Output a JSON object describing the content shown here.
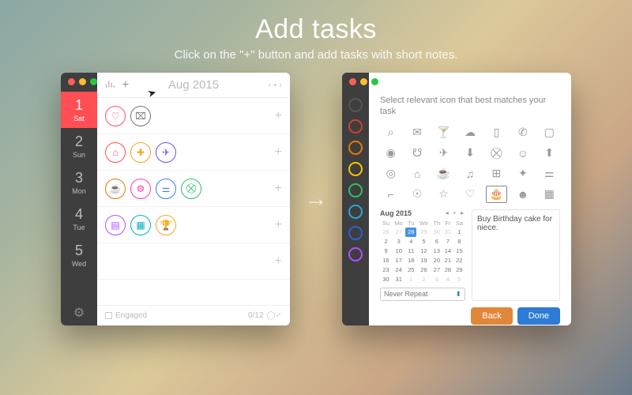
{
  "hero": {
    "title": "Add tasks",
    "subtitle": "Click on the \"+\" button and add tasks with short notes."
  },
  "left": {
    "month_label": "Aug 2015",
    "days": [
      {
        "num": "1",
        "dow": "Sat",
        "selected": true
      },
      {
        "num": "2",
        "dow": "Sun",
        "selected": false
      },
      {
        "num": "3",
        "dow": "Mon",
        "selected": false
      },
      {
        "num": "4",
        "dow": "Tue",
        "selected": false
      },
      {
        "num": "5",
        "dow": "Wed",
        "selected": false
      }
    ],
    "rows": [
      [
        {
          "icon": "heart",
          "color": "#ff4f6e"
        },
        {
          "icon": "card",
          "color": "#777"
        }
      ],
      [
        {
          "icon": "home",
          "color": "#ff4f55"
        },
        {
          "icon": "med",
          "color": "#f5a623"
        },
        {
          "icon": "plane",
          "color": "#6e50ff"
        }
      ],
      [
        {
          "icon": "cup",
          "color": "#e07b00"
        },
        {
          "icon": "bike",
          "color": "#ff3ea5"
        },
        {
          "icon": "dumbbell",
          "color": "#3b7cff"
        },
        {
          "icon": "cart",
          "color": "#2bbf6a"
        }
      ],
      [
        {
          "icon": "clipboard",
          "color": "#b24fff"
        },
        {
          "icon": "calendar",
          "color": "#00b1c9"
        },
        {
          "icon": "trophy",
          "color": "#f5a623"
        }
      ],
      []
    ],
    "footer": {
      "engaged": "Engaged",
      "count": "0/12"
    }
  },
  "right": {
    "prompt": "Select relevant icon that best matches your task",
    "colors": [
      "#555",
      "#d0402f",
      "#e07b00",
      "#f5c400",
      "#2bbf6a",
      "#2aa6d6",
      "#2e5fd6",
      "#b24fff"
    ],
    "icons": [
      "camera",
      "mail",
      "cocktail",
      "chat",
      "phone",
      "call",
      "monitor",
      "webcam",
      "people",
      "plane",
      "download",
      "cart",
      "user",
      "upload",
      "eye",
      "home",
      "cup",
      "music",
      "gift",
      "run",
      "dumbbell",
      "lamp",
      "bulb",
      "star",
      "heart",
      "cake",
      "user2",
      "grid"
    ],
    "selected_icon": "cake",
    "calendar": {
      "label": "Aug 2015",
      "dows": [
        "Su",
        "Mo",
        "Tu",
        "We",
        "Th",
        "Fr",
        "Sa"
      ],
      "weeks": [
        [
          {
            "d": "26",
            "o": 1
          },
          {
            "d": "27",
            "o": 1
          },
          {
            "d": "28",
            "o": 1,
            "t": 1
          },
          {
            "d": "29",
            "o": 1
          },
          {
            "d": "30",
            "o": 1
          },
          {
            "d": "31",
            "o": 1
          },
          {
            "d": "1"
          }
        ],
        [
          {
            "d": "2"
          },
          {
            "d": "3"
          },
          {
            "d": "4"
          },
          {
            "d": "5"
          },
          {
            "d": "6"
          },
          {
            "d": "7"
          },
          {
            "d": "8"
          }
        ],
        [
          {
            "d": "9"
          },
          {
            "d": "10"
          },
          {
            "d": "11"
          },
          {
            "d": "12"
          },
          {
            "d": "13"
          },
          {
            "d": "14"
          },
          {
            "d": "15"
          }
        ],
        [
          {
            "d": "16"
          },
          {
            "d": "17"
          },
          {
            "d": "18"
          },
          {
            "d": "19"
          },
          {
            "d": "20"
          },
          {
            "d": "21"
          },
          {
            "d": "22"
          }
        ],
        [
          {
            "d": "23"
          },
          {
            "d": "24"
          },
          {
            "d": "25"
          },
          {
            "d": "26"
          },
          {
            "d": "27"
          },
          {
            "d": "28"
          },
          {
            "d": "29"
          }
        ],
        [
          {
            "d": "30"
          },
          {
            "d": "31"
          },
          {
            "d": "1",
            "o": 1
          },
          {
            "d": "2",
            "o": 1
          },
          {
            "d": "3",
            "o": 1
          },
          {
            "d": "4",
            "o": 1
          },
          {
            "d": "5",
            "o": 1
          }
        ]
      ],
      "repeat": "Never Repeat"
    },
    "note": "Buy Birthday cake for niece.",
    "buttons": {
      "back": "Back",
      "done": "Done"
    }
  },
  "glyphs": {
    "heart": "♡",
    "card": "⌧",
    "home": "⌂",
    "med": "✚",
    "plane": "✈",
    "cup": "☕",
    "bike": "⚙",
    "dumbbell": "⚌",
    "cart": "⛒",
    "clipboard": "▤",
    "calendar": "▦",
    "trophy": "🏆",
    "camera": "⌕",
    "mail": "✉",
    "cocktail": "🍸",
    "chat": "☁",
    "phone": "▯",
    "call": "✆",
    "monitor": "▢",
    "webcam": "◉",
    "people": "☋",
    "download": "⬇",
    "user": "☺",
    "upload": "⬆",
    "eye": "◎",
    "music": "♫",
    "gift": "⊞",
    "run": "✦",
    "lamp": "⌐",
    "bulb": "☉",
    "star": "☆",
    "cake": "🎂",
    "user2": "☻",
    "grid": "▦"
  }
}
